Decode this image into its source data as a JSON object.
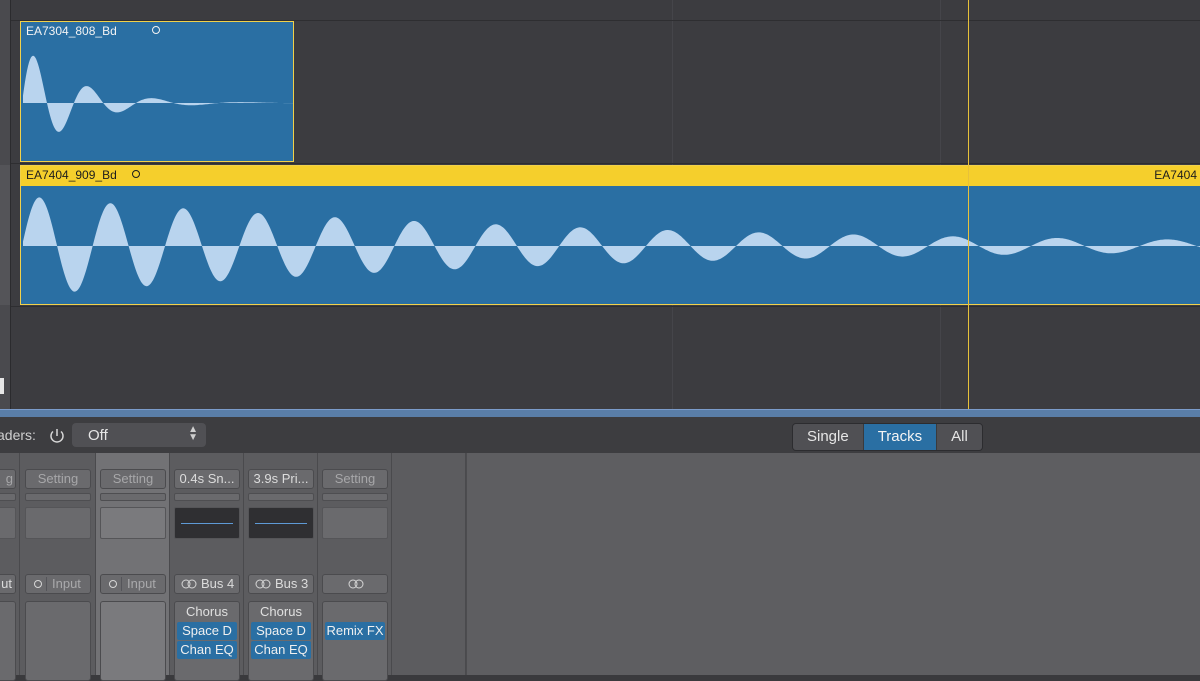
{
  "tracks": {
    "region1": {
      "name": "EA7304_808_Bd"
    },
    "region2": {
      "name": "EA7404_909_Bd",
      "name_right": "EA7404"
    },
    "colors": {
      "region_fill": "#2a6fa3",
      "wave_fill": "#b9d4ee",
      "selected_header": "#f5cf2c",
      "playhead": "#e7c13a"
    }
  },
  "mixer": {
    "faders_label": "aders:",
    "faders_value": "Off",
    "view_tabs": [
      {
        "label": "Single",
        "active": false
      },
      {
        "label": "Tracks",
        "active": true
      },
      {
        "label": "All",
        "active": false
      }
    ],
    "strips": [
      {
        "setting": "g",
        "io": "ut",
        "fx": []
      },
      {
        "setting": "Setting",
        "io": "Input",
        "fx": []
      },
      {
        "setting": "Setting",
        "io": "Input",
        "fx": [],
        "selected": true
      },
      {
        "setting": "0.4s Sn...",
        "io": "Bus 4",
        "fx": [
          "Chorus",
          "Space D",
          "Chan EQ"
        ]
      },
      {
        "setting": "3.9s Pri...",
        "io": "Bus 3",
        "fx": [
          "Chorus",
          "Space D",
          "Chan EQ"
        ]
      },
      {
        "setting": "Setting",
        "io": "",
        "fx": [
          "",
          "Remix FX"
        ]
      }
    ]
  }
}
